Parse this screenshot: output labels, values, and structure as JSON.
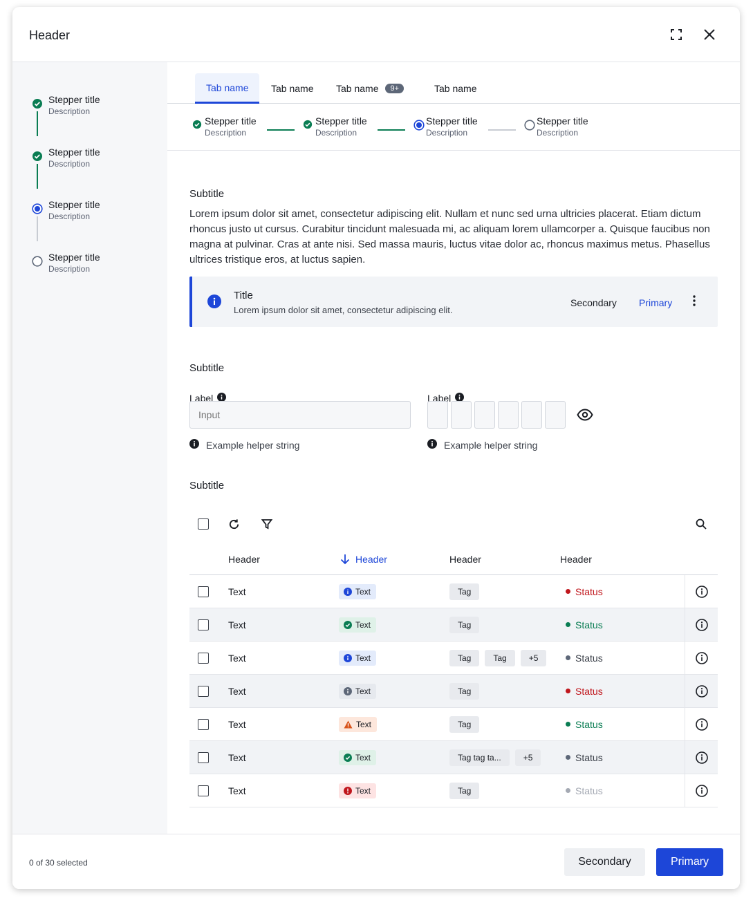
{
  "modal": {
    "title": "Header",
    "icons": {
      "expand": "expand-icon",
      "close": "close-icon"
    }
  },
  "sidebar": {
    "steps": [
      {
        "title": "Stepper title",
        "description": "Description",
        "state": "complete"
      },
      {
        "title": "Stepper title",
        "description": "Description",
        "state": "complete"
      },
      {
        "title": "Stepper title",
        "description": "Description",
        "state": "current"
      },
      {
        "title": "Stepper title",
        "description": "Description",
        "state": "pending"
      }
    ]
  },
  "tabs": [
    {
      "label": "Tab name",
      "active": true
    },
    {
      "label": "Tab name"
    },
    {
      "label": "Tab name",
      "badge": "9+"
    },
    {
      "label": "Tab name"
    }
  ],
  "stepper": {
    "steps": [
      {
        "title": "Stepper title",
        "description": "Description",
        "state": "complete"
      },
      {
        "title": "Stepper title",
        "description": "Description",
        "state": "complete"
      },
      {
        "title": "Stepper title",
        "description": "Description",
        "state": "current"
      },
      {
        "title": "Stepper title",
        "description": "Description",
        "state": "pending"
      }
    ]
  },
  "section1": {
    "subtitle": "Subtitle",
    "paragraph": "Lorem ipsum dolor sit amet, consectetur adipiscing elit. Nullam et nunc sed urna ultricies placerat. Etiam dictum rhoncus justo ut cursus. Curabitur tincidunt malesuada mi, ac aliquam lorem ullamcorper a. Quisque faucibus non magna at pulvinar. Cras at ante nisi. Sed massa mauris, luctus vitae dolor ac, rhoncus maximus metus. Phasellus ultrices tristique eros, at luctus sapien."
  },
  "notification": {
    "title": "Title",
    "text": "Lorem ipsum dolor sit amet, consectetur adipiscing elit.",
    "secondary": "Secondary",
    "primary": "Primary",
    "icon": "info-icon"
  },
  "section2": {
    "subtitle": "Subtitle",
    "field1": {
      "label": "Label",
      "placeholder": "Input",
      "helper": "Example helper string"
    },
    "field2": {
      "label": "Label",
      "helper": "Example helper string",
      "digits": 6
    }
  },
  "section3": {
    "subtitle": "Subtitle",
    "table": {
      "headers": [
        "Header",
        "Header",
        "Header",
        "Header"
      ],
      "sorted_column": 1,
      "rows": [
        {
          "text": "Text",
          "pill": {
            "text": "Text",
            "kind": "info"
          },
          "tags": [
            "Tag"
          ],
          "status": {
            "text": "Status",
            "kind": "error"
          }
        },
        {
          "text": "Text",
          "pill": {
            "text": "Text",
            "kind": "success"
          },
          "tags": [
            "Tag"
          ],
          "status": {
            "text": "Status",
            "kind": "success"
          }
        },
        {
          "text": "Text",
          "pill": {
            "text": "Text",
            "kind": "info"
          },
          "tags": [
            "Tag",
            "Tag",
            "+5"
          ],
          "status": {
            "text": "Status",
            "kind": "neutral"
          }
        },
        {
          "text": "Text",
          "pill": {
            "text": "Text",
            "kind": "neutral"
          },
          "tags": [
            "Tag"
          ],
          "status": {
            "text": "Status",
            "kind": "error"
          }
        },
        {
          "text": "Text",
          "pill": {
            "text": "Text",
            "kind": "warn"
          },
          "tags": [
            "Tag"
          ],
          "status": {
            "text": "Status",
            "kind": "success"
          }
        },
        {
          "text": "Text",
          "pill": {
            "text": "Text",
            "kind": "success"
          },
          "tags": [
            "Tag tag ta...",
            "+5"
          ],
          "status": {
            "text": "Status",
            "kind": "neutral"
          }
        },
        {
          "text": "Text",
          "pill": {
            "text": "Text",
            "kind": "error"
          },
          "tags": [
            "Tag"
          ],
          "status": {
            "text": "Status",
            "kind": "disabled"
          }
        }
      ]
    }
  },
  "footer": {
    "count": "0 of 30 selected",
    "secondary": "Secondary",
    "primary": "Primary"
  },
  "colors": {
    "accent": "#1d46d8",
    "success": "#0a7d53",
    "error": "#c0161c",
    "warn": "#d8531a",
    "neutral": "#5d6778",
    "disabled": "#a4a9b3"
  }
}
